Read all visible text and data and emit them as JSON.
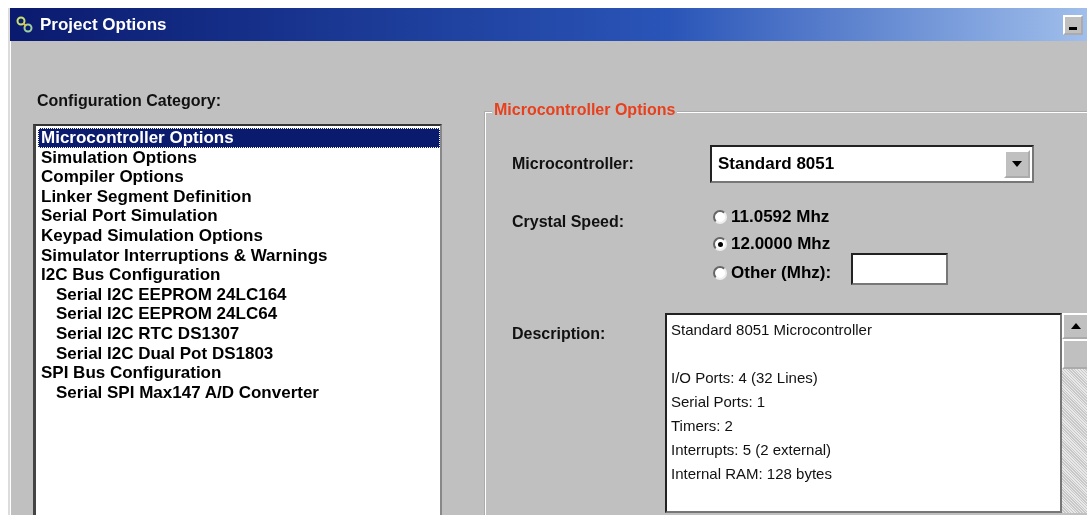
{
  "window": {
    "title": "Project Options"
  },
  "category": {
    "label": "Configuration Category:",
    "items": [
      {
        "label": "Microcontroller Options",
        "selected": true
      },
      {
        "label": "Simulation Options",
        "selected": false
      },
      {
        "label": "Compiler Options",
        "selected": false
      },
      {
        "label": "Linker Segment Definition",
        "selected": false
      },
      {
        "label": "Serial Port Simulation",
        "selected": false
      },
      {
        "label": "Keypad Simulation Options",
        "selected": false
      },
      {
        "label": "Simulator Interruptions & Warnings",
        "selected": false
      },
      {
        "label": "I2C Bus Configuration",
        "selected": false,
        "children": [
          {
            "label": "Serial I2C EEPROM 24LC164",
            "selected": false
          },
          {
            "label": "Serial I2C EEPROM 24LC64",
            "selected": false
          },
          {
            "label": "Serial I2C RTC DS1307",
            "selected": false
          },
          {
            "label": "Serial I2C Dual Pot DS1803",
            "selected": false
          }
        ]
      },
      {
        "label": "SPI Bus Configuration",
        "selected": false,
        "children": [
          {
            "label": "Serial SPI Max147 A/D Converter",
            "selected": false
          }
        ]
      }
    ]
  },
  "microcontroller_options": {
    "title": "Microcontroller Options",
    "microcontroller": {
      "label": "Microcontroller:",
      "value": "Standard 8051"
    },
    "crystal_speed": {
      "label": "Crystal Speed:",
      "options": [
        {
          "label": "11.0592 Mhz",
          "selected": false
        },
        {
          "label": "12.0000 Mhz",
          "selected": true
        },
        {
          "label": "Other (Mhz):",
          "selected": false,
          "kind": "other"
        }
      ]
    },
    "description": {
      "label": "Description:",
      "heading": "Standard 8051 Microcontroller",
      "lines": [
        "I/O Ports: 4 (32 Lines)",
        "Serial Ports: 1",
        "Timers: 2",
        "Interrupts: 5 (2 external)",
        "Internal RAM: 128 bytes"
      ]
    }
  }
}
